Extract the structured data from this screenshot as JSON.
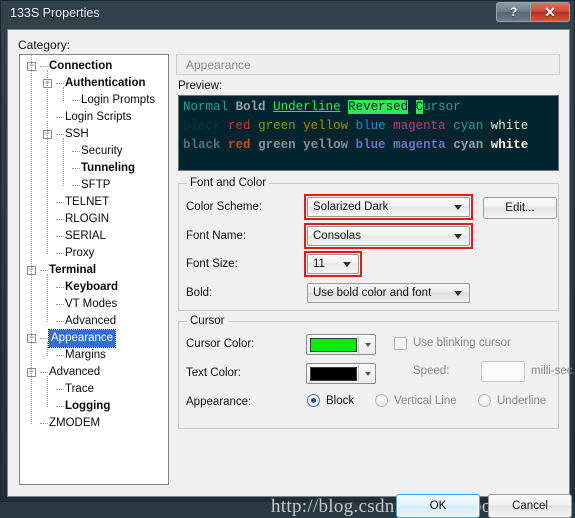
{
  "window": {
    "title": "133S Properties",
    "help_button": "?",
    "close_button": "✕"
  },
  "category": {
    "label": "Category:",
    "tree": [
      {
        "label": "Connection",
        "depth": 0,
        "bold": true,
        "expander": true,
        "selected": false
      },
      {
        "label": "Authentication",
        "depth": 1,
        "bold": true,
        "expander": true,
        "selected": false
      },
      {
        "label": "Login Prompts",
        "depth": 2,
        "bold": false,
        "expander": false,
        "selected": false
      },
      {
        "label": "Login Scripts",
        "depth": 1,
        "bold": false,
        "expander": false,
        "selected": false
      },
      {
        "label": "SSH",
        "depth": 1,
        "bold": false,
        "expander": true,
        "selected": false
      },
      {
        "label": "Security",
        "depth": 2,
        "bold": false,
        "expander": false,
        "selected": false
      },
      {
        "label": "Tunneling",
        "depth": 2,
        "bold": true,
        "expander": false,
        "selected": false
      },
      {
        "label": "SFTP",
        "depth": 2,
        "bold": false,
        "expander": false,
        "selected": false
      },
      {
        "label": "TELNET",
        "depth": 1,
        "bold": false,
        "expander": false,
        "selected": false
      },
      {
        "label": "RLOGIN",
        "depth": 1,
        "bold": false,
        "expander": false,
        "selected": false
      },
      {
        "label": "SERIAL",
        "depth": 1,
        "bold": false,
        "expander": false,
        "selected": false
      },
      {
        "label": "Proxy",
        "depth": 1,
        "bold": false,
        "expander": false,
        "selected": false
      },
      {
        "label": "Terminal",
        "depth": 0,
        "bold": true,
        "expander": true,
        "selected": false
      },
      {
        "label": "Keyboard",
        "depth": 1,
        "bold": true,
        "expander": false,
        "selected": false
      },
      {
        "label": "VT Modes",
        "depth": 1,
        "bold": false,
        "expander": false,
        "selected": false
      },
      {
        "label": "Advanced",
        "depth": 1,
        "bold": false,
        "expander": false,
        "selected": false
      },
      {
        "label": "Appearance",
        "depth": 0,
        "bold": false,
        "expander": true,
        "selected": true
      },
      {
        "label": "Margins",
        "depth": 1,
        "bold": false,
        "expander": false,
        "selected": false
      },
      {
        "label": "Advanced",
        "depth": 0,
        "bold": false,
        "expander": true,
        "selected": false
      },
      {
        "label": "Trace",
        "depth": 1,
        "bold": false,
        "expander": false,
        "selected": false
      },
      {
        "label": "Logging",
        "depth": 1,
        "bold": true,
        "expander": false,
        "selected": false
      },
      {
        "label": "ZMODEM",
        "depth": 0,
        "bold": false,
        "expander": false,
        "selected": false
      }
    ]
  },
  "page": {
    "header_title": "Appearance",
    "preview_label": "Preview:",
    "preview": {
      "background": "#00252e",
      "line1": [
        {
          "text": "Normal",
          "color": "#2aa198",
          "style": "normal"
        },
        {
          "text": " ",
          "color": "#2aa198",
          "style": "normal"
        },
        {
          "text": "Bold",
          "color": "#93a1a1",
          "style": "bold"
        },
        {
          "text": " ",
          "color": "#93a1a1",
          "style": "normal"
        },
        {
          "text": "Underline",
          "color": "#2ee854",
          "style": "underline"
        },
        {
          "text": " ",
          "color": "#2ee854",
          "style": "normal"
        },
        {
          "text": "Reversed",
          "color": "#00252e",
          "style": "reversed"
        },
        {
          "text": " ",
          "color": "#2ee854",
          "style": "normal"
        },
        {
          "text": "C",
          "color": "#00252e",
          "style": "cursor"
        },
        {
          "text": "ursor",
          "color": "#2aa198",
          "style": "normal"
        }
      ],
      "line2": [
        {
          "text": "black",
          "color": "#073642"
        },
        {
          "text": " ",
          "color": "#073642"
        },
        {
          "text": "red",
          "color": "#dc322f"
        },
        {
          "text": " ",
          "color": "#073642"
        },
        {
          "text": "green",
          "color": "#859900"
        },
        {
          "text": " ",
          "color": "#073642"
        },
        {
          "text": "yellow",
          "color": "#b58900"
        },
        {
          "text": " ",
          "color": "#073642"
        },
        {
          "text": "blue",
          "color": "#268bd2"
        },
        {
          "text": " ",
          "color": "#073642"
        },
        {
          "text": "magenta",
          "color": "#d33682"
        },
        {
          "text": " ",
          "color": "#073642"
        },
        {
          "text": "cyan",
          "color": "#2aa198"
        },
        {
          "text": " ",
          "color": "#073642"
        },
        {
          "text": "white",
          "color": "#eee8d5"
        }
      ],
      "line3": [
        {
          "text": "black",
          "color": "#586e75"
        },
        {
          "text": " ",
          "color": "#586e75"
        },
        {
          "text": "red",
          "color": "#cb4b16"
        },
        {
          "text": " ",
          "color": "#586e75"
        },
        {
          "text": "green",
          "color": "#839496"
        },
        {
          "text": " ",
          "color": "#586e75"
        },
        {
          "text": "yellow",
          "color": "#839496"
        },
        {
          "text": " ",
          "color": "#586e75"
        },
        {
          "text": "blue",
          "color": "#6c71c4"
        },
        {
          "text": " ",
          "color": "#586e75"
        },
        {
          "text": "magenta",
          "color": "#6c71c4"
        },
        {
          "text": " ",
          "color": "#586e75"
        },
        {
          "text": "cyan",
          "color": "#93a1a1"
        },
        {
          "text": " ",
          "color": "#586e75"
        },
        {
          "text": "white",
          "color": "#fdf6e3"
        }
      ]
    },
    "font_and_color": {
      "legend": "Font and Color",
      "color_scheme_label": "Color Scheme:",
      "color_scheme_value": "Solarized Dark",
      "edit_button": "Edit...",
      "font_name_label": "Font Name:",
      "font_name_value": "Consolas",
      "font_size_label": "Font Size:",
      "font_size_value": "11",
      "bold_label": "Bold:",
      "bold_value": "Use bold color and font",
      "highlight_color": "#e51b1b"
    },
    "cursor": {
      "legend": "Cursor",
      "cursor_color_label": "Cursor Color:",
      "cursor_color_value": "#00ee00",
      "text_color_label": "Text Color:",
      "text_color_value": "#000000",
      "blinking_label": "Use blinking cursor",
      "blinking_checked": false,
      "speed_label": "Speed:",
      "speed_value": "",
      "speed_unit": "milli-sec.",
      "appearance_label": "Appearance:",
      "appearance_options": [
        {
          "label": "Block",
          "selected": true
        },
        {
          "label": "Vertical Line",
          "selected": false
        },
        {
          "label": "Underline",
          "selected": false
        }
      ]
    }
  },
  "footer": {
    "ok_label": "OK",
    "cancel_label": "Cancel",
    "watermark": "http://blog.csdn.net/loveaborn"
  }
}
